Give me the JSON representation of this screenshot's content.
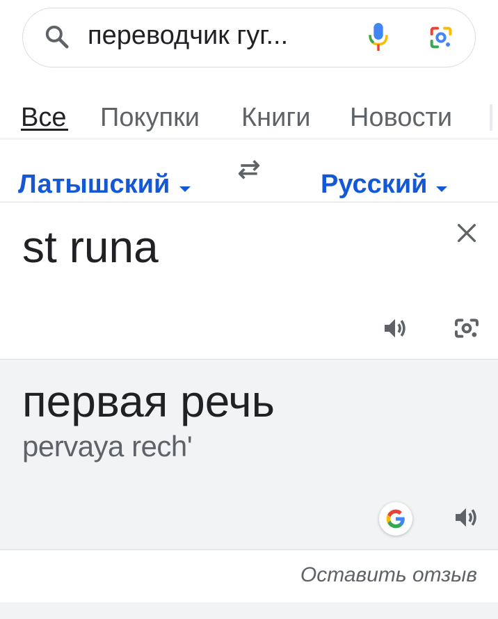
{
  "search": {
    "query": "переводчик гуг..."
  },
  "tabs": [
    {
      "label": "Все",
      "active": true
    },
    {
      "label": "Покупки",
      "active": false
    },
    {
      "label": "Книги",
      "active": false
    },
    {
      "label": "Новости",
      "active": false
    }
  ],
  "translator": {
    "source_language": "Латышский",
    "target_language": "Русский",
    "source_text": "st runa",
    "translation": "первая речь",
    "transliteration": "pervaya rech'",
    "feedback_link": "Оставить отзыв"
  },
  "icons": {
    "search": "search-icon",
    "mic": "microphone-icon",
    "lens": "google-lens-icon",
    "swap": "swap-languages-icon",
    "clear": "close-icon",
    "listen": "speaker-icon",
    "camera": "camera-icon",
    "google": "google-g-icon"
  },
  "colors": {
    "accent": "#1558d6",
    "text": "#202124",
    "muted": "#5f6368",
    "output_background": "#f1f3f4",
    "google_blue": "#4285f4",
    "google_red": "#ea4335",
    "google_yellow": "#fbbc05",
    "google_green": "#34a853"
  }
}
